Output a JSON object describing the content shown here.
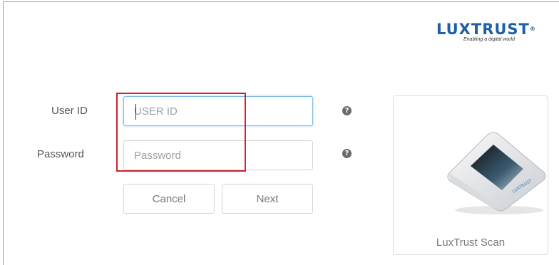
{
  "brand": {
    "logo_text": "LUXTRUST",
    "logo_reg": "®",
    "tagline": "Enabling a digital world",
    "color": "#1f5fa6"
  },
  "form": {
    "user_id": {
      "label": "User ID",
      "placeholder": "USER ID",
      "value": ""
    },
    "password": {
      "label": "Password",
      "placeholder": "Password",
      "value": ""
    },
    "help_glyph": "?",
    "cancel_label": "Cancel",
    "next_label": "Next"
  },
  "device_card": {
    "caption": "LuxTrust Scan",
    "device_label": "LUXTRUST",
    "icon": "luxtrust-scan-device-icon"
  },
  "colors": {
    "frame_border": "#4fc3bd",
    "highlight": "#d0202a",
    "focus_border": "#7db6e4"
  }
}
